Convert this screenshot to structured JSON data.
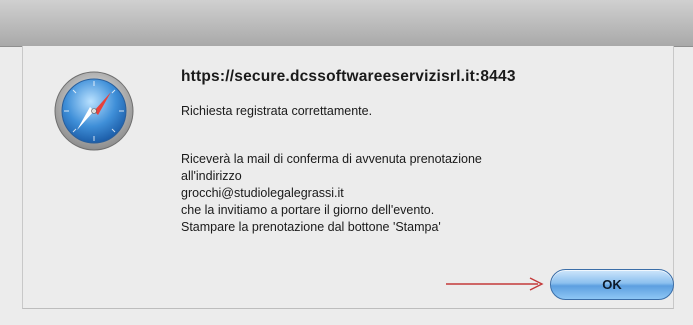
{
  "dialog": {
    "host": "https://secure.dcssoftwareeservizisrl.it:8443",
    "status": "Richiesta registrata correttamente.",
    "details": [
      "Riceverà la mail di conferma di avvenuta prenotazione",
      "all'indirizzo",
      "grocchi@studiolegalegrassi.it",
      "che la invitiamo a portare il giorno dell'evento.",
      "Stampare la prenotazione dal bottone 'Stampa'"
    ],
    "ok_label": "OK",
    "app_icon": "safari-compass-icon",
    "arrow_icon": "red-arrow-icon"
  },
  "colors": {
    "arrow": "#c43a3a",
    "button_blue": "#5d9fe0"
  }
}
